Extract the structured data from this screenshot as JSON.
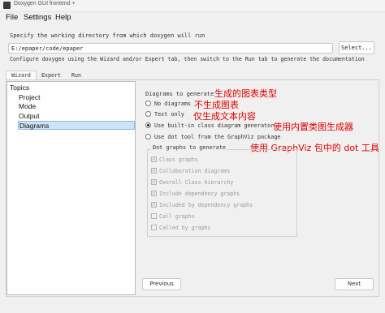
{
  "window": {
    "title": "Doxygen GUI frontend +"
  },
  "menu": {
    "file": "File",
    "settings": "Settings",
    "help": "Help"
  },
  "working_dir": {
    "label": "Specify the working directory from which doxygen will run",
    "value": "E:/epaper/code/epaper",
    "select_button": "Select..."
  },
  "configure_text": "Configure doxygen using the Wizard and/or Expert tab, then switch to the Run tab to generate the documentation",
  "tabs": [
    {
      "label": "Wizard"
    },
    {
      "label": "Expert"
    },
    {
      "label": "Run"
    }
  ],
  "active_tab": "Wizard",
  "topics": {
    "header": "Topics",
    "items": [
      {
        "label": "Project"
      },
      {
        "label": "Mode"
      },
      {
        "label": "Output"
      },
      {
        "label": "Diagrams"
      }
    ],
    "selected": "Diagrams"
  },
  "diagrams": {
    "title": "Diagrams to generate",
    "options": [
      {
        "label": "No diagrams",
        "selected": false
      },
      {
        "label": "Text only",
        "selected": false
      },
      {
        "label": "Use built-in class diagram generator",
        "selected": true
      },
      {
        "label": "Use dot tool from the GraphViz package",
        "selected": false
      }
    ],
    "dot_group": {
      "title": "Dot graphs to generate",
      "items": [
        {
          "label": "Class graphs",
          "checked": true
        },
        {
          "label": "Collaboration diagrams",
          "checked": true
        },
        {
          "label": "Overall Class hierarchy",
          "checked": true
        },
        {
          "label": "Include dependency graphs",
          "checked": true
        },
        {
          "label": "Included by dependency graphs",
          "checked": true
        },
        {
          "label": "Call graphs",
          "checked": false
        },
        {
          "label": "Called by graphs",
          "checked": false
        }
      ]
    }
  },
  "annotations": {
    "title": "生成的图表类型",
    "no_diagrams": "不生成图表",
    "text_only": "仅生成文本内容",
    "builtin": "使用内置类图生成器",
    "dot": "使用 GraphViz 包中的 dot 工具"
  },
  "buttons": {
    "previous": "Previous",
    "next": "Next"
  },
  "colors": {
    "annotation": "#e00000",
    "selection": "#cde3f7"
  }
}
